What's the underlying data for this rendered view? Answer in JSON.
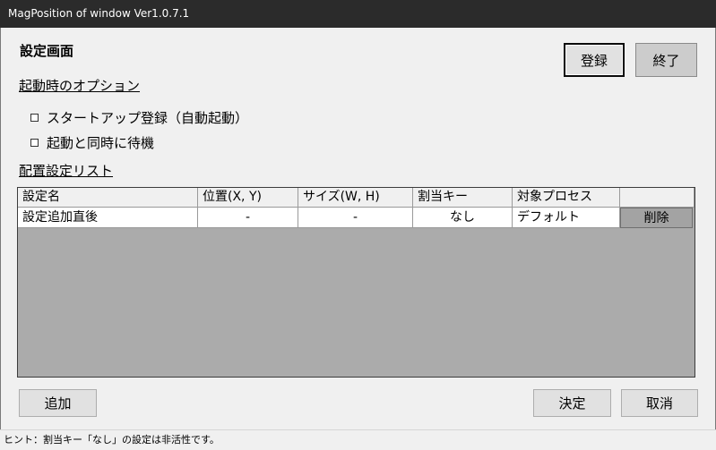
{
  "window": {
    "title": "MagPosition of window Ver1.0.7.1"
  },
  "header": {
    "title": "設定画面"
  },
  "toolbar": {
    "register_label": "登録",
    "exit_label": "終了"
  },
  "options": {
    "section_label": "起動時のオプション",
    "startup_register": {
      "label": "スタートアップ登録（自動起動）",
      "checked": false
    },
    "wait_on_start": {
      "label": "起動と同時に待機",
      "checked": false
    }
  },
  "list": {
    "section_label": "配置設定リスト",
    "columns": [
      "設定名",
      "位置(X, Y)",
      "サイズ(W, H)",
      "割当キー",
      "対象プロセス",
      ""
    ],
    "rows": [
      {
        "name": "設定追加直後",
        "position": "-",
        "size": "-",
        "hotkey": "なし",
        "process": "デフォルト",
        "delete_label": "削除"
      }
    ]
  },
  "footer": {
    "add_label": "追加",
    "ok_label": "決定",
    "cancel_label": "取消"
  },
  "status": {
    "hint": "ヒント：割当キー「なし」の設定は非活性です。"
  }
}
